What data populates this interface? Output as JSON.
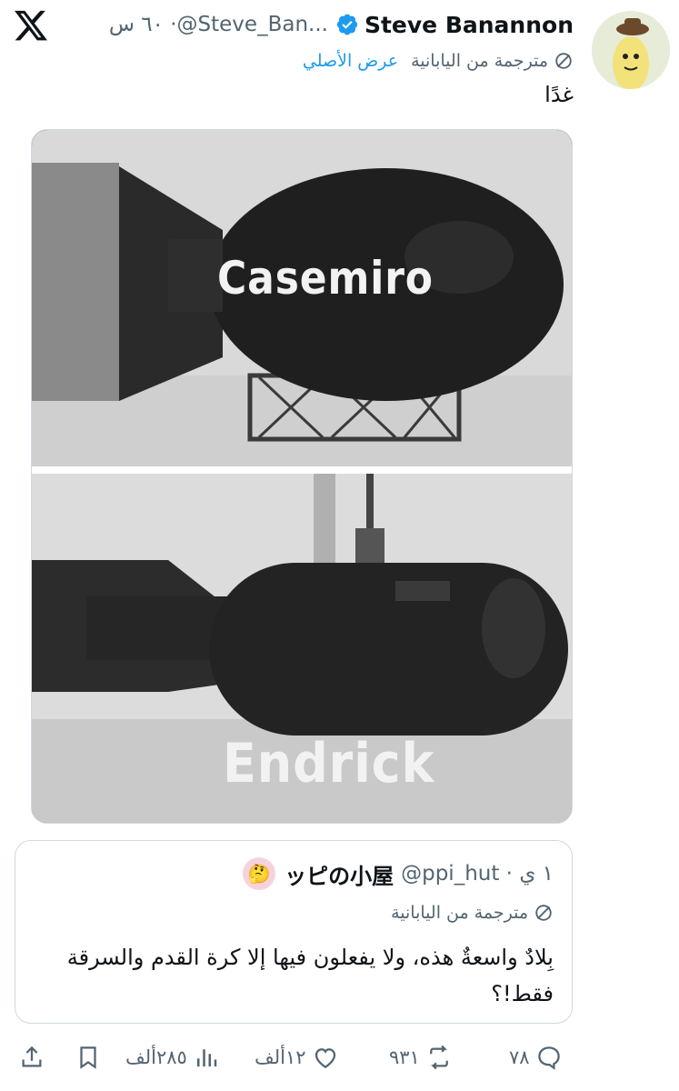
{
  "header": {
    "logo": "x-logo-icon",
    "display_name": "Steve Banannon",
    "handle_time": "٦٠ س ·@Steve_Ban...",
    "translated_from": "مترجمة من اليابانية",
    "show_original": "عرض الأصلي"
  },
  "tweet": {
    "text": "غدًا"
  },
  "media": {
    "photo1_label": "Casemiro",
    "photo2_label": "Endrick"
  },
  "quote": {
    "name": "ッピの小屋",
    "handle_time": "@ppi_hut · ١ ي",
    "translated_from": "مترجمة من اليابانية",
    "text": "بِلادٌ واسعةٌ هذه، ولا يفعلون فيها إلا كرة القدم والسرقة فقط!؟"
  },
  "actions": {
    "replies": "٧٨",
    "reposts": "٩٣١",
    "likes": "١٢ألف",
    "views": "٢٨٥ألف"
  },
  "colors": {
    "accent": "#1d9bf0",
    "muted": "#536471",
    "border": "#cfd9de"
  }
}
